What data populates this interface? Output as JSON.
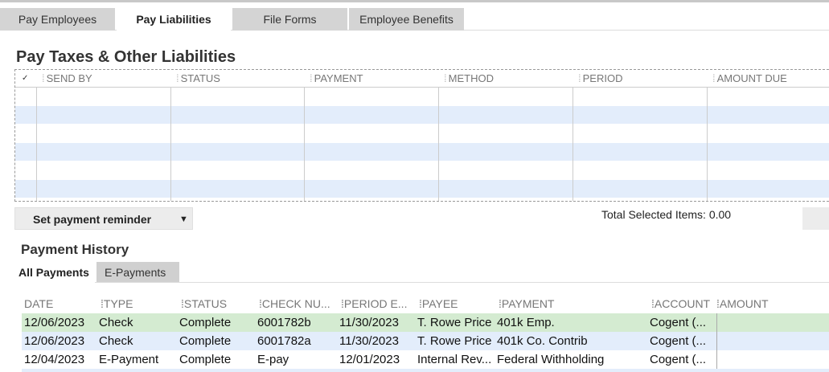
{
  "tabs": [
    "Pay Employees",
    "Pay Liabilities",
    "File Forms",
    "Employee Benefits"
  ],
  "liabilities": {
    "title": "Pay Taxes & Other Liabilities",
    "check_header": "✓",
    "columns": [
      "SEND BY",
      "STATUS",
      "PAYMENT",
      "METHOD",
      "PERIOD",
      "AMOUNT DUE"
    ]
  },
  "reminder_button": "Set payment reminder",
  "dropdown_glyph": "▼",
  "total_selected": "Total Selected Items: 0.00",
  "history": {
    "title": "Payment History",
    "tabs": [
      "All Payments",
      "E-Payments"
    ],
    "columns": [
      "DATE",
      "TYPE",
      "STATUS",
      "CHECK NU...",
      "PERIOD E...",
      "PAYEE",
      "PAYMENT",
      "ACCOUNT",
      "AMOUNT"
    ],
    "rows": [
      [
        "12/06/2023",
        "Check",
        "Complete",
        "6001782b",
        "11/30/2023",
        "T. Rowe Price",
        "401k Emp.",
        "Cogent (...",
        ""
      ],
      [
        "12/06/2023",
        "Check",
        "Complete",
        "6001782a",
        "11/30/2023",
        "T. Rowe Price",
        "401k Co. Contrib",
        "Cogent (...",
        ""
      ],
      [
        "12/04/2023",
        "E-Payment",
        "Complete",
        "E-pay",
        "12/01/2023",
        "Internal Rev...",
        "Federal Withholding",
        "Cogent (...",
        ""
      ]
    ]
  }
}
